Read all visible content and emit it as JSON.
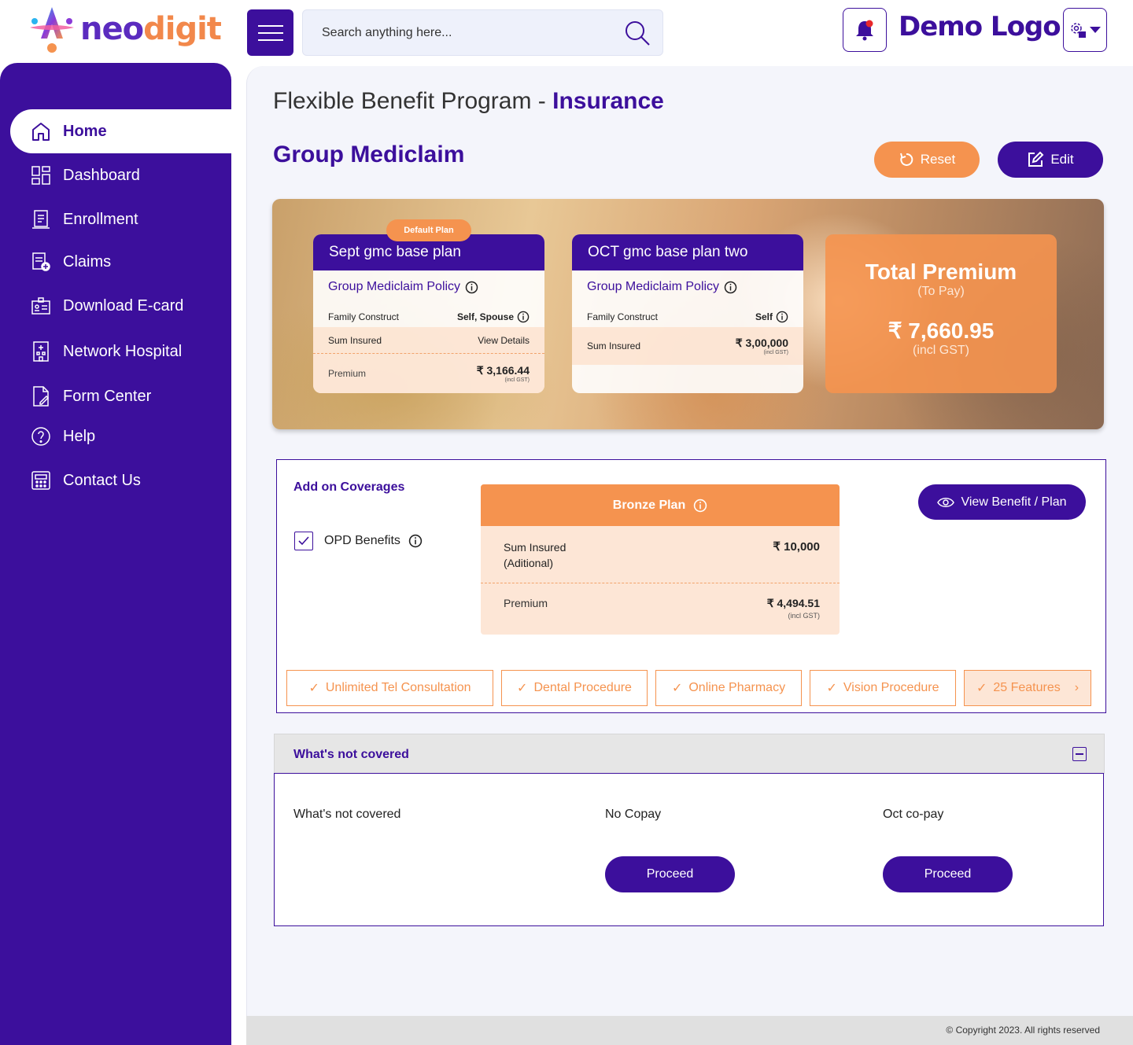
{
  "brand": {
    "logo_part1": "neo",
    "logo_part2": "digit",
    "client_logo": "Demo Logo"
  },
  "search": {
    "placeholder": "Search anything here..."
  },
  "icons": {
    "menu": "hamburger-icon",
    "search": "search-icon",
    "notification": "bell-icon",
    "settings": "gear-icon"
  },
  "colors": {
    "primary": "#3c0f9c",
    "accent": "#f5934f",
    "accent_light": "#fde6d6"
  },
  "sidebar": {
    "items": [
      {
        "label": "Home",
        "icon": "home-icon",
        "active": true
      },
      {
        "label": "Dashboard",
        "icon": "dashboard-icon"
      },
      {
        "label": "Enrollment",
        "icon": "enrollment-icon"
      },
      {
        "label": "Claims",
        "icon": "claims-icon"
      },
      {
        "label": "Download E-card",
        "icon": "ecard-icon"
      },
      {
        "label": "Network Hospital",
        "icon": "hospital-icon"
      },
      {
        "label": "Form Center",
        "icon": "form-icon"
      },
      {
        "label": "Help",
        "icon": "help-icon"
      },
      {
        "label": "Contact Us",
        "icon": "contact-icon"
      }
    ]
  },
  "header": {
    "title_prefix": "Flexible Benefit Program - ",
    "title_highlight": "Insurance",
    "section": "Group Mediclaim",
    "reset_label": "Reset",
    "edit_label": "Edit"
  },
  "plans": [
    {
      "badge": "Default Plan",
      "name": "Sept gmc base plan",
      "policy": "Group Mediclaim Policy",
      "family_label": "Family Construct",
      "family_value": "Self, Spouse",
      "sum_label": "Sum Insured",
      "sum_value": "View Details",
      "premium_label": "Premium",
      "premium_value": "₹ 3,166.44",
      "gst_note": "(incl GST)"
    },
    {
      "name": "OCT gmc base plan two",
      "policy": "Group Mediclaim Policy",
      "family_label": "Family Construct",
      "family_value": "Self",
      "sum_label": "Sum Insured",
      "sum_value": "₹ 3,00,000",
      "gst_note": "(incl GST)"
    }
  ],
  "total": {
    "title": "Total Premium",
    "subtitle": "(To Pay)",
    "amount": "₹ 7,660.95",
    "note": "(incl GST)"
  },
  "addon": {
    "title": "Add on Coverages",
    "opd_label": "OPD Benefits",
    "opd_checked": true,
    "bronze": {
      "title": "Bronze Plan",
      "sum_label_1": "Sum Insured",
      "sum_label_2": "(Aditional)",
      "sum_value": "₹ 10,000",
      "premium_label": "Premium",
      "premium_value": "₹ 4,494.51",
      "gst_note": "(incl GST)"
    },
    "view_label": "View Benefit / Plan",
    "features": [
      "Unlimited Tel Consultation",
      "Dental Procedure",
      "Online Pharmacy",
      "Vision Procedure"
    ],
    "more_label": "25 Features"
  },
  "not_covered": {
    "title": "What's not covered",
    "col1": "What's not covered",
    "col2": "No Copay",
    "col3": "Oct co-pay",
    "proceed_label": "Proceed"
  },
  "footer": {
    "copyright": "© Copyright 2023. All rights reserved"
  }
}
